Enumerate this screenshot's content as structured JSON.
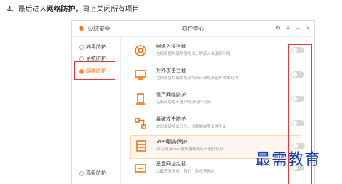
{
  "instruction": {
    "prefix": "4、最后进入",
    "bold": "网络防护",
    "suffix": "，同上关闭所有项目"
  },
  "window": {
    "app_name": "火绒安全",
    "title": "防护中心",
    "controls": [
      "↻",
      "≡",
      "–",
      "×"
    ]
  },
  "sidebar": {
    "items": [
      {
        "label": "病毒防护"
      },
      {
        "label": "系统防护"
      },
      {
        "label": "网络防护"
      },
      {
        "label": "高级防护"
      }
    ]
  },
  "rows": [
    {
      "name": "网络入侵拦截",
      "desc": "在网络层拦截黑客攻击，屏蔽入侵漏洞利用",
      "on": false
    },
    {
      "name": "对外攻击拦截",
      "desc": "在网络层拦截本机对外部计算机发起的攻击行为",
      "on": false
    },
    {
      "name": "僵尸网络防护",
      "desc": "在网络层阻止僵尸网络进行访问",
      "on": false
    },
    {
      "name": "暴破攻击防护",
      "desc": "发现暴破攻击行为，拦截暴破登录并阻止",
      "on": false
    },
    {
      "name": "Web服务保护",
      "desc": "针对服务Web服务器漏洞攻击进行防护",
      "on": false
    },
    {
      "name": "恶意网址拦截",
      "desc": "拦截恶意网址、欺诈、钓鱼等网站",
      "on": false
    }
  ],
  "colors": {
    "accent": "#ff6a00",
    "annotation_red": "#e03a3a",
    "toggle_off": "#d6d6d6"
  },
  "watermark": "最需教育"
}
